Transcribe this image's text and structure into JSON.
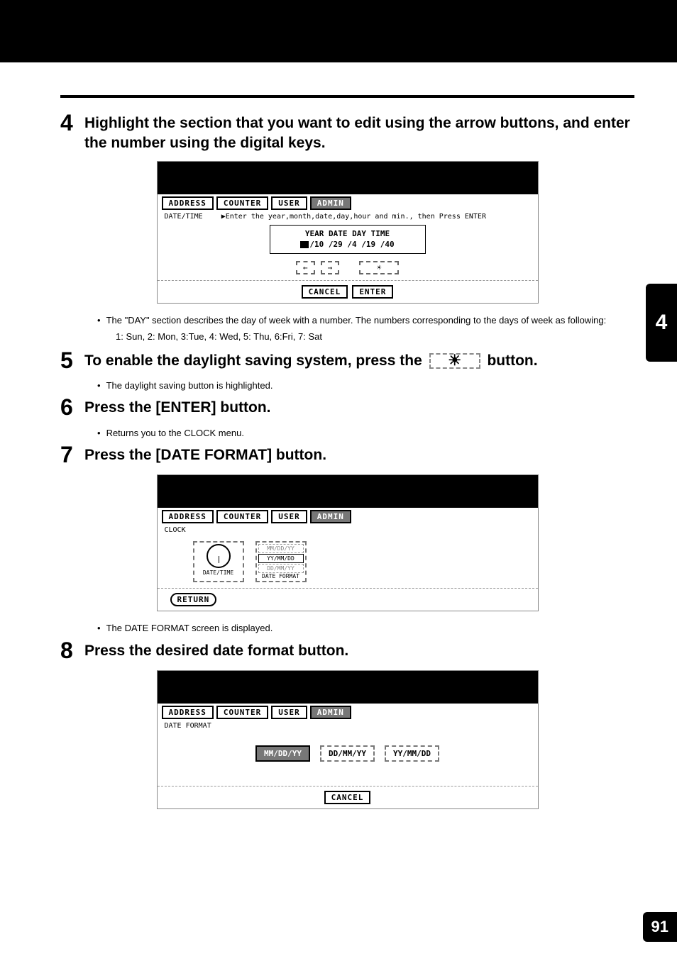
{
  "sideTab": "4",
  "pageNumber": "91",
  "step4": {
    "num": "4",
    "text": "Highlight the section that you want to edit using the arrow buttons, and enter the number using the digital keys.",
    "screen": {
      "tabs": {
        "address": "ADDRESS",
        "counter": "COUNTER",
        "user": "USER",
        "admin": "ADMIN"
      },
      "screenLabel": "DATE/TIME",
      "prompt": "▶Enter the year,month,date,day,hour and min., then Press ENTER",
      "fieldsHeader": "YEAR  DATE  DAY  TIME",
      "fieldsValues": "/10 /29 /4  /19 /40",
      "arrowLeft": "←",
      "arrowRight": "→",
      "dst": "☀",
      "cancel": "CANCEL",
      "enter": "ENTER"
    },
    "bullet": "The \"DAY\" section describes the day of week with a number.  The numbers corresponding to the days of week as following:",
    "bulletLine2": "1: Sun, 2: Mon, 3:Tue, 4: Wed, 5: Thu, 6:Fri, 7: Sat"
  },
  "step5": {
    "num": "5",
    "textBefore": "To enable the daylight saving system, press the",
    "dstIcon": "☀",
    "textAfter": "button.",
    "bullet": "The daylight saving button is highlighted."
  },
  "step6": {
    "num": "6",
    "text": "Press the [ENTER] button.",
    "bullet": "Returns you to the CLOCK menu."
  },
  "step7": {
    "num": "7",
    "text": "Press the [DATE FORMAT] button.",
    "screen": {
      "tabs": {
        "address": "ADDRESS",
        "counter": "COUNTER",
        "user": "USER",
        "admin": "ADMIN"
      },
      "screenLabel": "CLOCK",
      "dateTimeLabel": "DATE/TIME",
      "fmt1": "MM/DD/YY",
      "fmt2": "YY/MM/DD",
      "fmt3": "DD/MM/YY",
      "dateFormatLabel": "DATE FORMAT",
      "return": "RETURN"
    },
    "bullet": "The DATE FORMAT screen is displayed."
  },
  "step8": {
    "num": "8",
    "text": "Press the desired date format button.",
    "screen": {
      "tabs": {
        "address": "ADDRESS",
        "counter": "COUNTER",
        "user": "USER",
        "admin": "ADMIN"
      },
      "screenLabel": "DATE FORMAT",
      "opt1": "MM/DD/YY",
      "opt2": "DD/MM/YY",
      "opt3": "YY/MM/DD",
      "cancel": "CANCEL"
    }
  }
}
